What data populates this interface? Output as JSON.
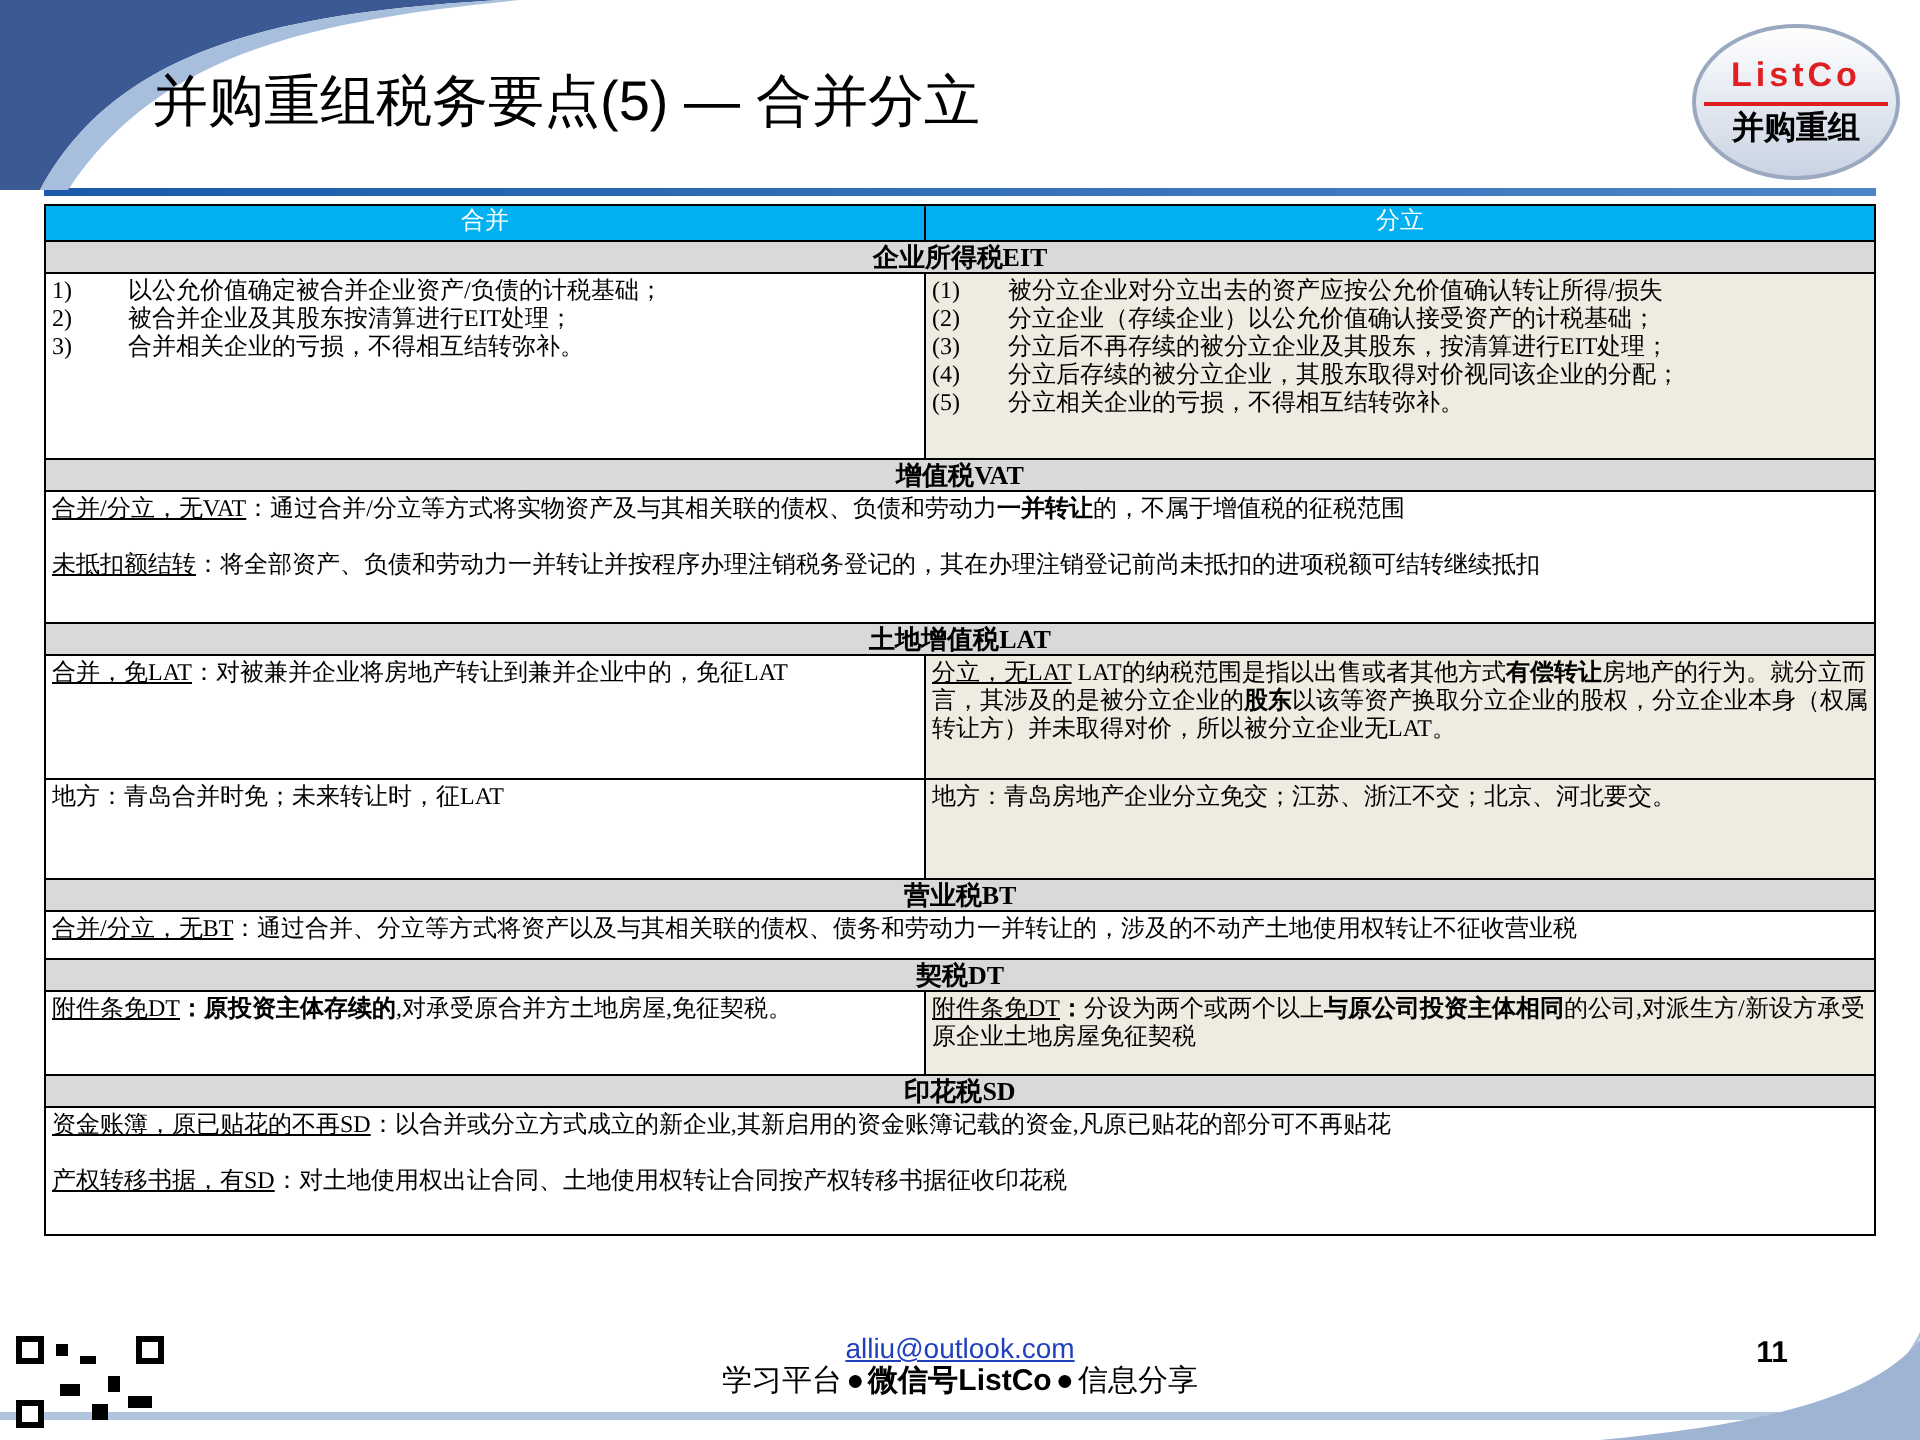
{
  "title": "并购重组税务要点(5) — 合并分立",
  "logo": {
    "top": "ListCo",
    "bottom": "并购重组"
  },
  "columns": [
    "合并",
    "分立"
  ],
  "sections": [
    {
      "heading": "企业所得税EIT",
      "rows": [
        {
          "kind": "split",
          "left": {
            "shaded": false,
            "blocks": [
              {
                "kind": "list",
                "items": [
                  {
                    "marker": "1)",
                    "text": "以公允价值确定被合并企业资产/负债的计税基础；"
                  },
                  {
                    "marker": "2)",
                    "text": "被合并企业及其股东按清算进行EIT处理；"
                  },
                  {
                    "marker": "3)",
                    "text": "合并相关企业的亏损，不得相互结转弥补。"
                  }
                ]
              }
            ]
          },
          "right": {
            "shaded": true,
            "blocks": [
              {
                "kind": "list",
                "items": [
                  {
                    "marker": "(1)",
                    "text": "被分立企业对分立出去的资产应按公允价值确认转让所得/损失"
                  },
                  {
                    "marker": "(2)",
                    "text": "分立企业（存续企业）以公允价值确认接受资产的计税基础；"
                  },
                  {
                    "marker": "(3)",
                    "text": "分立后不再存续的被分立企业及其股东，按清算进行EIT处理；"
                  },
                  {
                    "marker": "(4)",
                    "text": "分立后存续的被分立企业，其股东取得对价视同该企业的分配；"
                  },
                  {
                    "marker": "(5)",
                    "text": "分立相关企业的亏损，不得相互结转弥补。"
                  }
                ]
              }
            ]
          }
        }
      ]
    },
    {
      "heading": "增值税VAT",
      "rows": [
        {
          "kind": "span",
          "cell": {
            "blocks": [
              {
                "kind": "para",
                "lead": "合并/分立，无VAT",
                "text": "：通过合并/分立等方式将实物资产及与其相关联的债权、负债和劳动力**一并转让**的，不属于增值税的征税范围"
              },
              {
                "kind": "para",
                "lead": "未抵扣额结转",
                "text": "：将全部资产、负债和劳动力一并转让并按程序办理注销税务登记的，其在办理注销登记前尚未抵扣的进项税额可结转继续抵扣"
              }
            ]
          }
        }
      ]
    },
    {
      "heading": "土地增值税LAT",
      "rows": [
        {
          "kind": "split",
          "left": {
            "shaded": false,
            "blocks": [
              {
                "kind": "para",
                "lead": "合并，免LAT",
                "text": "：对被兼并企业将房地产转让到兼并企业中的，免征LAT"
              }
            ]
          },
          "right": {
            "shaded": true,
            "blocks": [
              {
                "kind": "para",
                "lead": "分立，无LAT",
                "text": " LAT的纳税范围是指以出售或者其他方式**有偿转让**房地产的行为。就分立而言，其涉及的是被分立企业的**股东**以该等资产换取分立企业的股权，分立企业本身（权属转让方）并未取得对价，所以被分立企业无LAT。"
              }
            ]
          }
        },
        {
          "kind": "split",
          "left": {
            "shaded": false,
            "blocks": [
              {
                "kind": "para",
                "text": "地方：青岛合并时免；未来转让时，征LAT"
              }
            ]
          },
          "right": {
            "shaded": true,
            "blocks": [
              {
                "kind": "para",
                "text": "地方：青岛房地产企业分立免交；江苏、浙江不交；北京、河北要交。"
              }
            ]
          }
        }
      ]
    },
    {
      "heading": "营业税BT",
      "rows": [
        {
          "kind": "span",
          "cell": {
            "blocks": [
              {
                "kind": "para",
                "lead": "合并/分立，无BT",
                "text": "：通过合并、分立等方式将资产以及与其相关联的债权、债务和劳动力一并转让的，涉及的不动产土地使用权转让不征收营业税"
              }
            ]
          }
        }
      ]
    },
    {
      "heading": "契税DT",
      "rows": [
        {
          "kind": "split",
          "left": {
            "shaded": false,
            "blocks": [
              {
                "kind": "para",
                "lead": "附件条免DT",
                "text": "**：原投资主体存续的**,对承受原合并方土地房屋,免征契税。"
              }
            ]
          },
          "right": {
            "shaded": true,
            "blocks": [
              {
                "kind": "para",
                "lead": "附件条免DT",
                "text": "**：**分设为两个或两个以上**与原公司投资主体相同**的公司,对派生方/新设方承受原企业土地房屋免征契税"
              }
            ]
          }
        }
      ]
    },
    {
      "heading": "印花税SD",
      "rows": [
        {
          "kind": "span",
          "cell": {
            "blocks": [
              {
                "kind": "para",
                "lead": "资金账簿，原已贴花的不再SD",
                "text": "：以合并或分立方式成立的新企业,其新启用的资金账簿记载的资金,凡原已贴花的部分可不再贴花"
              },
              {
                "kind": "para",
                "lead": "产权转移书据，有SD",
                "text": "：对土地使用权出让合同、土地使用权转让合同按产权转移书据征收印花税"
              }
            ]
          }
        }
      ]
    }
  ],
  "footer": {
    "email": "alliu@outlook.com",
    "tagline": [
      {
        "kind": "text",
        "text": "学习平台"
      },
      {
        "kind": "bullet",
        "text": "●"
      },
      {
        "kind": "bold",
        "text": "微信号ListCo"
      },
      {
        "kind": "bullet",
        "text": "●"
      },
      {
        "kind": "text",
        "text": "信息分享"
      }
    ],
    "page": "11"
  }
}
